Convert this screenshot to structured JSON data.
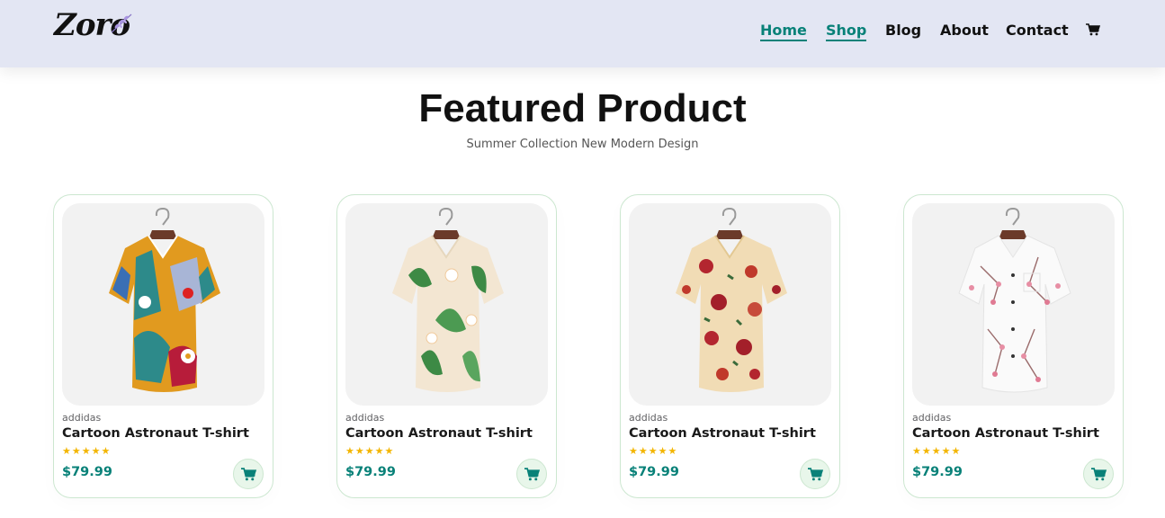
{
  "header": {
    "logo_text": "Zoro",
    "nav": [
      {
        "label": "Home",
        "active": true
      },
      {
        "label": "Shop",
        "active": true
      },
      {
        "label": "Blog",
        "active": false
      },
      {
        "label": "About",
        "active": false
      },
      {
        "label": "Contact",
        "active": false
      }
    ],
    "cart_icon": "cart-icon"
  },
  "section": {
    "title": "Featured Product",
    "subtitle": "Summer Collection New Modern Design"
  },
  "products": [
    {
      "brand": "addidas",
      "name": "Cartoon Astronaut T-shirt",
      "stars": "★★★★★",
      "rating": 5,
      "price": "$79.99",
      "image": "abstract-print-shirt"
    },
    {
      "brand": "addidas",
      "name": "Cartoon Astronaut T-shirt",
      "stars": "★★★★★",
      "rating": 5,
      "price": "$79.99",
      "image": "tropical-leaf-shirt"
    },
    {
      "brand": "addidas",
      "name": "Cartoon Astronaut T-shirt",
      "stars": "★★★★★",
      "rating": 5,
      "price": "$79.99",
      "image": "rose-floral-shirt"
    },
    {
      "brand": "addidas",
      "name": "Cartoon Astronaut T-shirt",
      "stars": "★★★★★",
      "rating": 5,
      "price": "$79.99",
      "image": "blossom-white-shirt"
    }
  ],
  "colors": {
    "accent": "#088178",
    "header_bg": "#e3e6f3",
    "star": "#f3b500",
    "card_border": "#cce7d0"
  }
}
